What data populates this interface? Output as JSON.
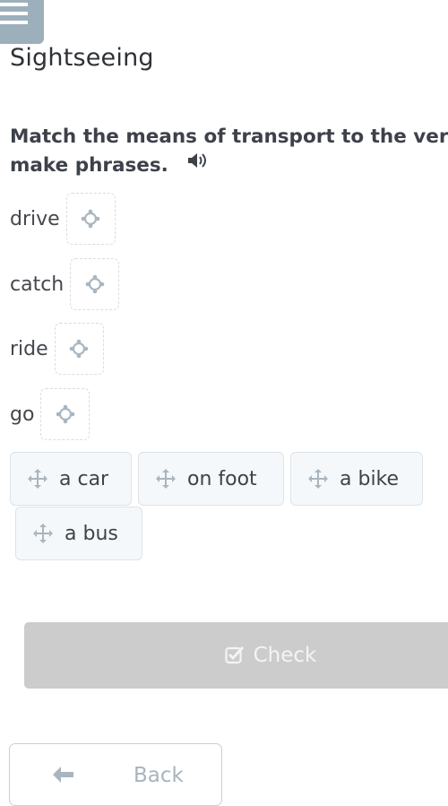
{
  "header": {
    "menu_icon": "hamburger-menu-icon",
    "title": "Sightseeing"
  },
  "exercise": {
    "instruction_line1": "Match the means of transport to the ver",
    "instruction_line2": "make phrases.",
    "audio_icon": "speaker-icon",
    "verbs": [
      {
        "label": "drive",
        "slot_icon": "drop-target-icon"
      },
      {
        "label": "catch",
        "slot_icon": "drop-target-icon"
      },
      {
        "label": "ride",
        "slot_icon": "drop-target-icon"
      },
      {
        "label": "go",
        "slot_icon": "drop-target-icon"
      }
    ],
    "options": [
      {
        "label": "a car",
        "icon": "move-arrows-icon"
      },
      {
        "label": "on foot",
        "icon": "move-arrows-icon"
      },
      {
        "label": "a bike",
        "icon": "move-arrows-icon"
      },
      {
        "label": "a bus",
        "icon": "move-arrows-icon"
      }
    ]
  },
  "actions": {
    "check_label": "Check",
    "check_icon": "checkbox-checked-icon",
    "back_label": "Back",
    "back_icon": "arrow-left-icon"
  },
  "colors": {
    "menu_bg": "#9cb0bc",
    "check_disabled_bg": "#cccccc",
    "chip_bg": "#f5f8fb",
    "icon_gray": "#a9b6c0"
  }
}
